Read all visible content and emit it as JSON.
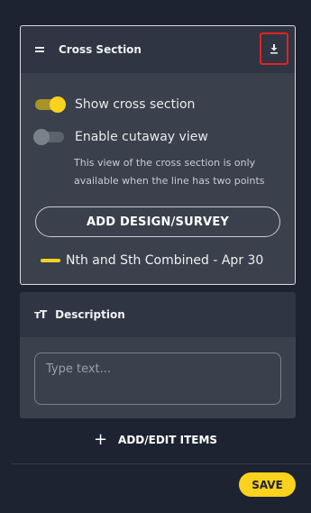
{
  "cross_section": {
    "title": "Cross Section",
    "drag_icon": "drag-handle-icon",
    "download_icon": "download-icon",
    "show_cross_section": {
      "label": "Show cross section",
      "enabled": true
    },
    "cutaway_view": {
      "label": "Enable cutaway view",
      "enabled": false
    },
    "info_text": "This view of the cross section is only available when the line has two points",
    "add_button_label": "ADD DESIGN/SURVEY",
    "legend_item": {
      "label": "Nth and Sth Combined - Apr 30",
      "color": "#fbd21e"
    }
  },
  "description": {
    "icon": "text-format-icon",
    "icon_glyph": "тT",
    "title": "Description",
    "placeholder": "Type text..."
  },
  "add_edit_items_label": "ADD/EDIT ITEMS",
  "add_icon_glyph": "+",
  "save_label": "SAVE",
  "colors": {
    "background": "#1d2330",
    "panel": "#3a404c",
    "panel_header": "#2f3542",
    "accent": "#fbd21e",
    "highlight_border": "#e32222"
  }
}
